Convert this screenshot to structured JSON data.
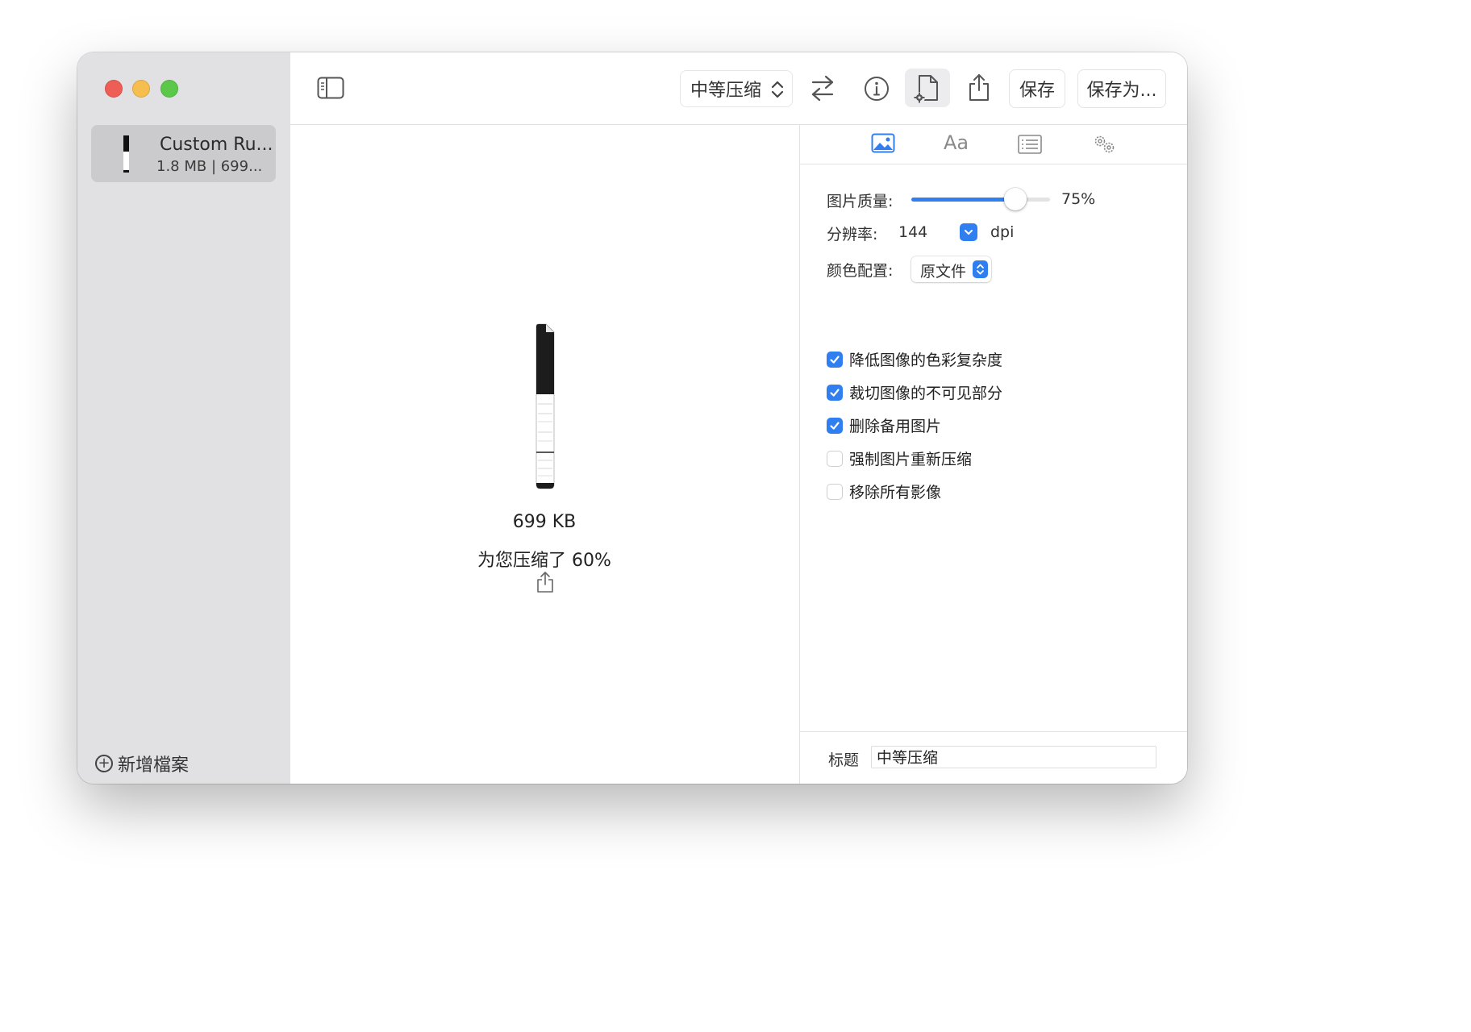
{
  "sidebar": {
    "file": {
      "name": "Custom Ru...",
      "meta": "1.8 MB | 699..."
    },
    "add_file_label": "新增檔案"
  },
  "toolbar": {
    "preset_label": "中等压缩",
    "save_label": "保存",
    "save_as_label": "保存为..."
  },
  "preview": {
    "size": "699 KB",
    "saved": "为您压缩了 60%"
  },
  "inspector": {
    "tabs": [
      "image-icon",
      "Aa",
      "text-list-icon",
      "gears-icon"
    ],
    "active_tab": 0,
    "quality_label": "图片质量:",
    "quality_value": 75,
    "quality_text": "75%",
    "resolution_label": "分辨率:",
    "resolution_value": "144",
    "resolution_unit": "dpi",
    "color_profile_label": "颜色配置:",
    "color_profile_value": "原文件",
    "options": [
      {
        "label": "降低图像的色彩复杂度",
        "checked": true
      },
      {
        "label": "裁切图像的不可见部分",
        "checked": true
      },
      {
        "label": "删除备用图片",
        "checked": true
      },
      {
        "label": "强制图片重新压缩",
        "checked": false
      },
      {
        "label": "移除所有影像",
        "checked": false
      }
    ],
    "title_label": "标题",
    "title_value": "中等压缩"
  },
  "colors": {
    "accent": "#2f7ff0",
    "sidebar_bg": "#e1e1e3",
    "selected_row": "#cbcbcd",
    "close": "#ee5e56",
    "minimize": "#f5be4f",
    "zoom": "#5cc84a"
  }
}
